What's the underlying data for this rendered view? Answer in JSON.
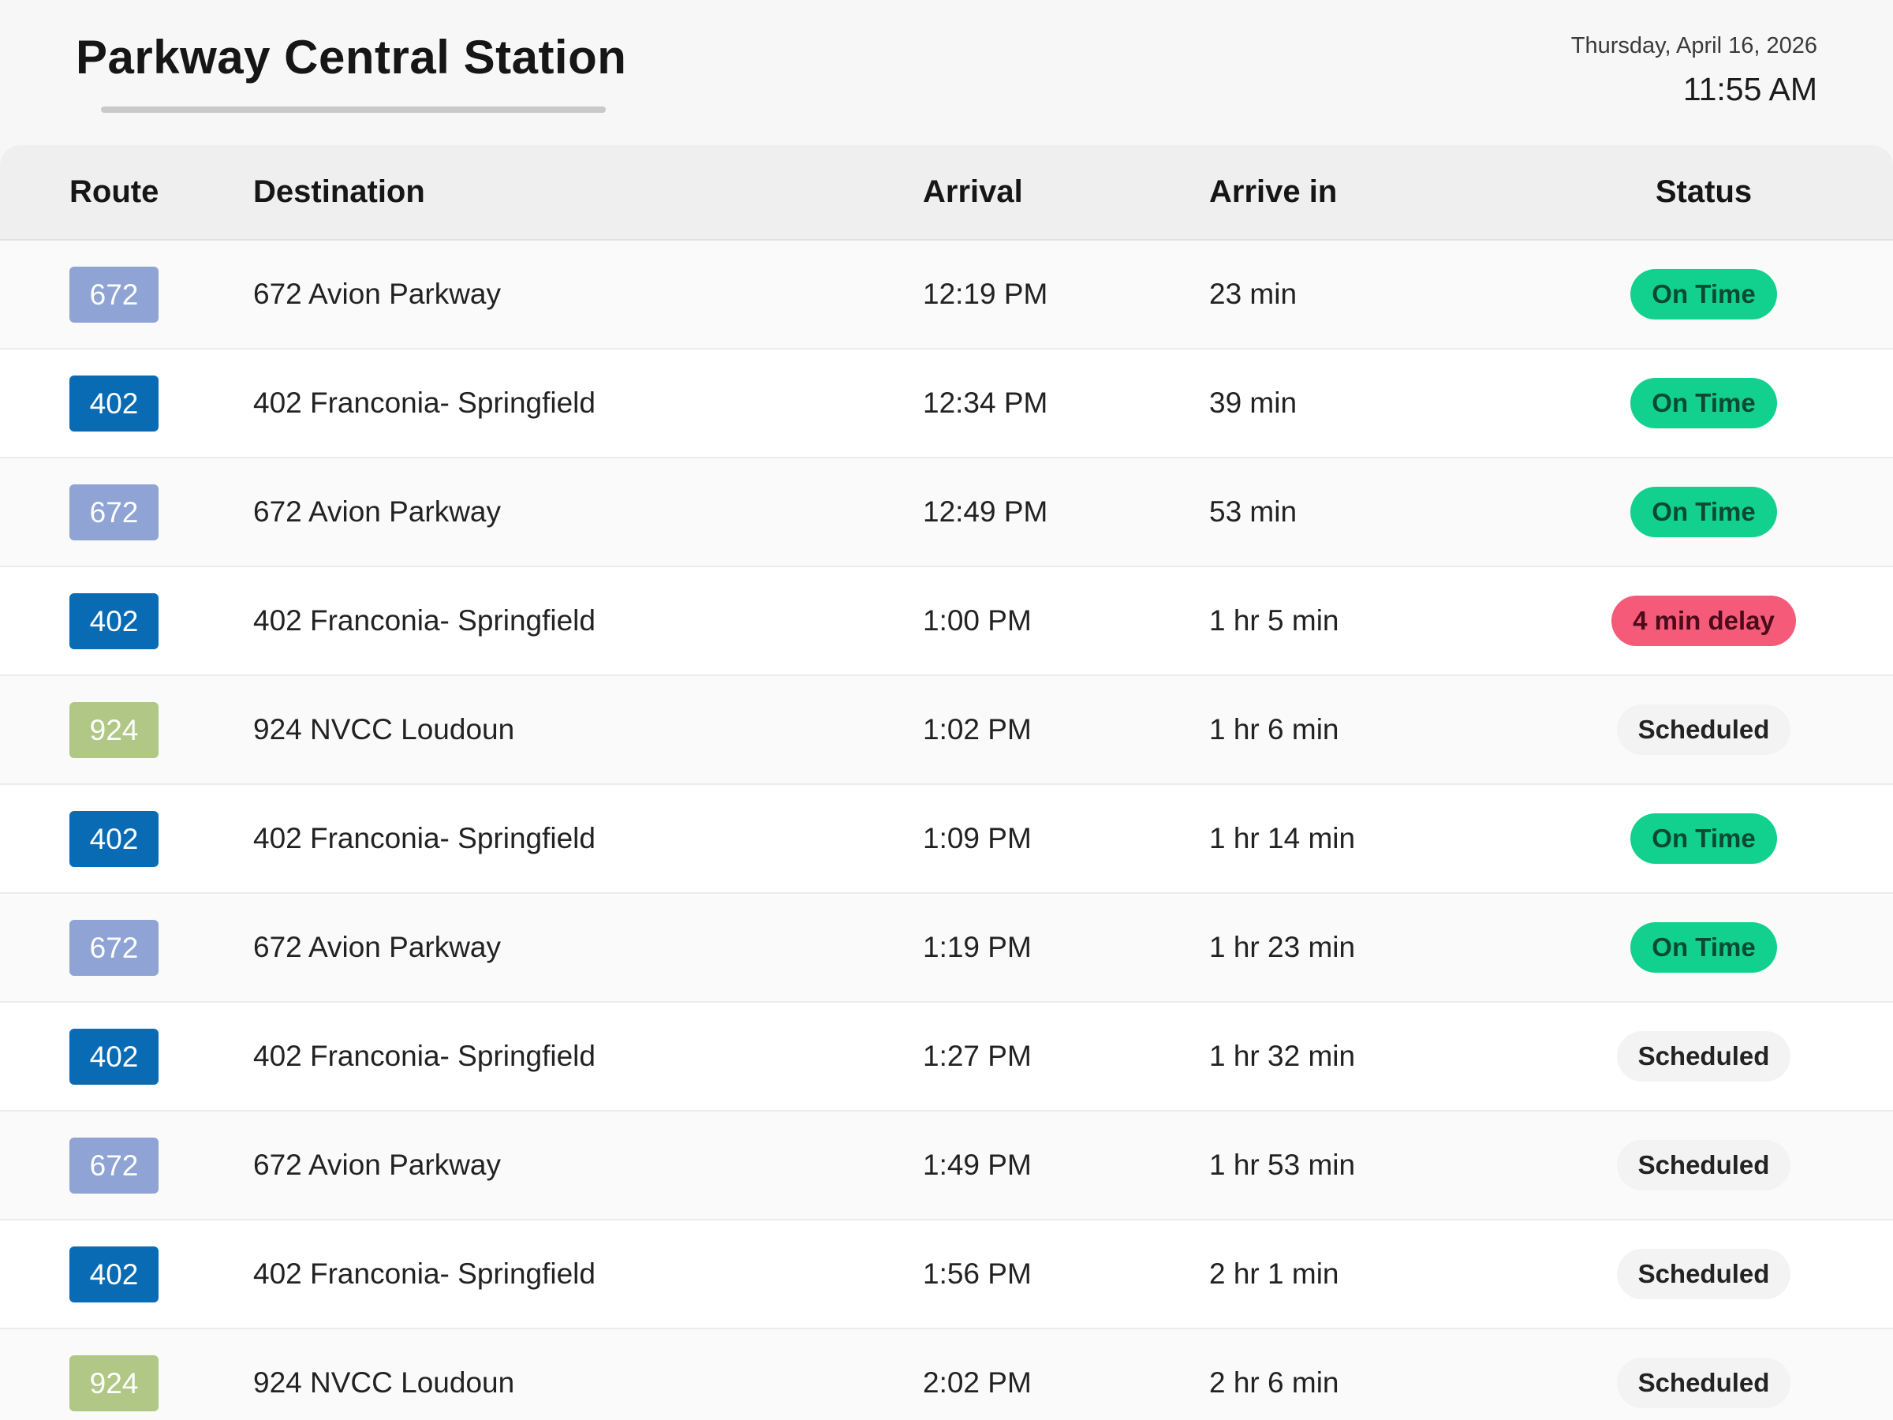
{
  "header": {
    "station_name": "Parkway Central Station",
    "date": "Thursday, April 16, 2026",
    "time": "11:55 AM"
  },
  "table": {
    "columns": {
      "route": "Route",
      "destination": "Destination",
      "arrival": "Arrival",
      "arrive_in": "Arrive in",
      "status": "Status"
    },
    "rows": [
      {
        "route": "672",
        "route_color": "#8fa4d4",
        "destination": "672 Avion Parkway",
        "arrival": "12:19 PM",
        "arrive_in": "23 min",
        "status": "On Time",
        "status_type": "ontime"
      },
      {
        "route": "402",
        "route_color": "#0a6bb5",
        "destination": "402 Franconia- Springfield",
        "arrival": "12:34 PM",
        "arrive_in": "39 min",
        "status": "On Time",
        "status_type": "ontime"
      },
      {
        "route": "672",
        "route_color": "#8fa4d4",
        "destination": "672 Avion Parkway",
        "arrival": "12:49 PM",
        "arrive_in": "53 min",
        "status": "On Time",
        "status_type": "ontime"
      },
      {
        "route": "402",
        "route_color": "#0a6bb5",
        "destination": "402 Franconia- Springfield",
        "arrival": "1:00 PM",
        "arrive_in": "1 hr 5 min",
        "status": "4 min delay",
        "status_type": "delay"
      },
      {
        "route": "924",
        "route_color": "#b0c785",
        "destination": "924 NVCC Loudoun",
        "arrival": "1:02 PM",
        "arrive_in": "1 hr 6 min",
        "status": "Scheduled",
        "status_type": "scheduled"
      },
      {
        "route": "402",
        "route_color": "#0a6bb5",
        "destination": "402 Franconia- Springfield",
        "arrival": "1:09 PM",
        "arrive_in": "1 hr 14 min",
        "status": "On Time",
        "status_type": "ontime"
      },
      {
        "route": "672",
        "route_color": "#8fa4d4",
        "destination": "672 Avion Parkway",
        "arrival": "1:19 PM",
        "arrive_in": "1 hr 23 min",
        "status": "On Time",
        "status_type": "ontime"
      },
      {
        "route": "402",
        "route_color": "#0a6bb5",
        "destination": "402 Franconia- Springfield",
        "arrival": "1:27 PM",
        "arrive_in": "1 hr 32 min",
        "status": "Scheduled",
        "status_type": "scheduled"
      },
      {
        "route": "672",
        "route_color": "#8fa4d4",
        "destination": "672 Avion Parkway",
        "arrival": "1:49 PM",
        "arrive_in": "1 hr 53 min",
        "status": "Scheduled",
        "status_type": "scheduled"
      },
      {
        "route": "402",
        "route_color": "#0a6bb5",
        "destination": "402 Franconia- Springfield",
        "arrival": "1:56 PM",
        "arrive_in": "2 hr 1 min",
        "status": "Scheduled",
        "status_type": "scheduled"
      },
      {
        "route": "924",
        "route_color": "#b0c785",
        "destination": "924 NVCC Loudoun",
        "arrival": "2:02 PM",
        "arrive_in": "2 hr 6 min",
        "status": "Scheduled",
        "status_type": "scheduled"
      }
    ]
  }
}
